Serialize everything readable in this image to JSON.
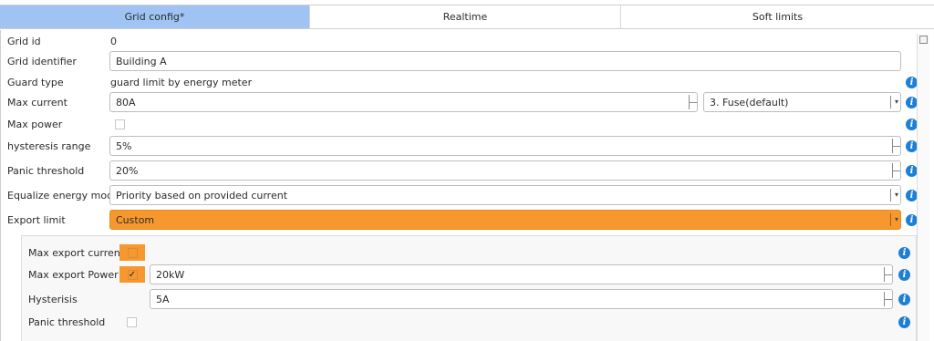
{
  "tabs": [
    {
      "label": "Grid config*",
      "active": true
    },
    {
      "label": "Realtime",
      "active": false
    },
    {
      "label": "Soft limits",
      "active": false
    }
  ],
  "form": {
    "grid_id": {
      "label": "Grid id",
      "value": "0"
    },
    "grid_identifier": {
      "label": "Grid identifier",
      "value": "Building A"
    },
    "guard_type": {
      "label": "Guard type",
      "value": "guard limit by energy meter"
    },
    "max_current": {
      "label": "Max current",
      "value": "80A",
      "fuse_option": "3. Fuse(default)"
    },
    "max_power": {
      "label": "Max power",
      "checked": false
    },
    "hysteresis_range": {
      "label": "hysteresis range",
      "value": "5%"
    },
    "panic_threshold": {
      "label": "Panic threshold",
      "value": "20%"
    },
    "equalize_energy_mode": {
      "label": "Equalize energy mode",
      "value": "Priority based on provided current"
    },
    "export_limit": {
      "label": "Export limit",
      "value": "Custom"
    }
  },
  "export_panel": {
    "max_export_current": {
      "label": "Max export current",
      "checked": false
    },
    "max_export_power": {
      "label": "Max export Power",
      "checked": true,
      "checkmark": "✓",
      "value": "20kW"
    },
    "hysterisis": {
      "label": "Hysterisis",
      "value": "5A"
    },
    "panic_threshold": {
      "label": "Panic threshold",
      "checked": false
    }
  },
  "icons": {
    "info": "i",
    "dropdown": "▾"
  },
  "colors": {
    "active_tab": "#9fc4f3",
    "accent_orange": "#f7982e",
    "info_blue": "#1e7fd6"
  }
}
